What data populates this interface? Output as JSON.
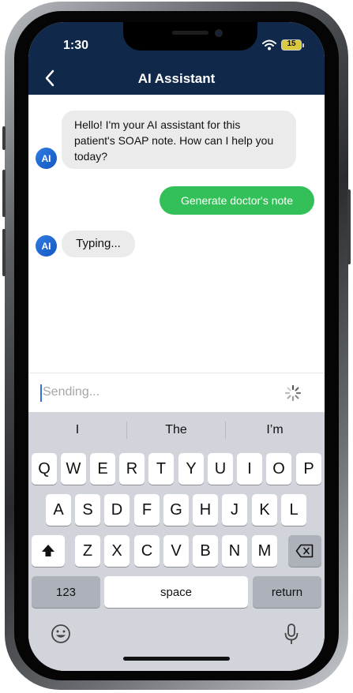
{
  "status_bar": {
    "time": "1:30",
    "battery": "15"
  },
  "header": {
    "title": "AI Assistant"
  },
  "messages": [
    {
      "sender": "AI",
      "lines": [
        "Hello! I'm your AI assistant for this",
        "patient's SOAP note. How can I help you",
        "today?"
      ]
    },
    {
      "sender": "user",
      "text": "Generate doctor's note"
    },
    {
      "sender": "AI",
      "text": "Typing..."
    }
  ],
  "input": {
    "value": "Sending..."
  },
  "keyboard": {
    "suggestions": [
      "I",
      "The",
      "I’m"
    ],
    "row1": [
      "Q",
      "W",
      "E",
      "R",
      "T",
      "Y",
      "U",
      "I",
      "O",
      "P"
    ],
    "row2": [
      "A",
      "S",
      "D",
      "F",
      "G",
      "H",
      "J",
      "K",
      "L"
    ],
    "row3": [
      "Z",
      "X",
      "C",
      "V",
      "B",
      "N",
      "M"
    ],
    "numbers_label": "123",
    "space_label": "space",
    "return_label": "return"
  },
  "colors": {
    "header": "#10284a",
    "user_bubble": "#34c058",
    "ai_bubble": "#ebebeb",
    "avatar": "#1f6ad8"
  }
}
